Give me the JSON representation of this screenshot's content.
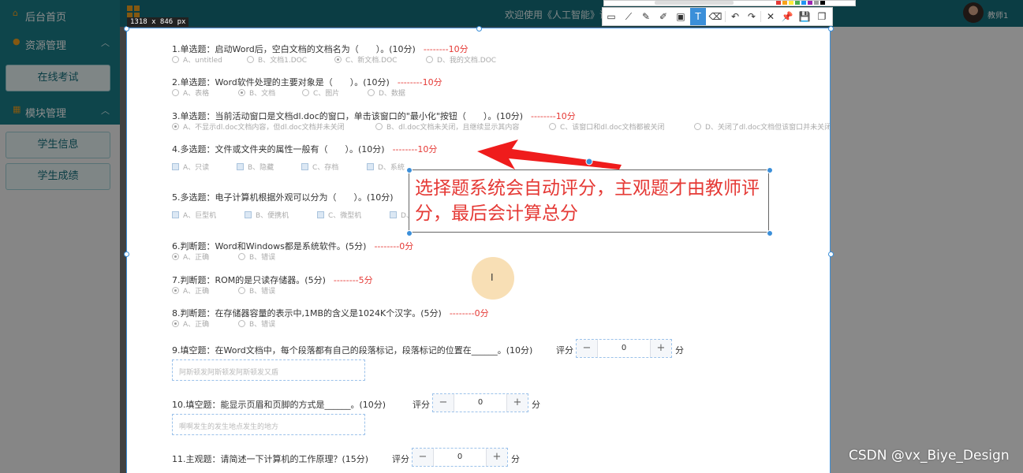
{
  "topbar": {
    "welcome": "欢迎使用《人工智能》课程",
    "username": "教师1"
  },
  "sidebar": {
    "home": "后台首页",
    "resource": "资源管理",
    "online_exam": "在线考试",
    "modules": "模块管理",
    "student_info": "学生信息",
    "student_scores": "学生成绩"
  },
  "size_badge": "1318 x 846  px",
  "questions": [
    {
      "title": "1.单选题：启动Word后，空白文档的文档名为（　　）。(10分)",
      "score": "--------10分",
      "options": [
        "A、untitled",
        "B、文档1.DOC",
        "C、新文档.DOC",
        "D、我的文档.DOC"
      ]
    },
    {
      "title": "2.单选题：Word软件处理的主要对象是（　　）。(10分)",
      "score": "--------10分",
      "options": [
        "A、表格",
        "B、文档",
        "C、图片",
        "D、数据"
      ]
    },
    {
      "title": "3.单选题：当前活动窗口是文档dl.doc的窗口，单击该窗口的\"最小化\"按钮（　　）。(10分)",
      "score": "--------10分",
      "options": [
        "A、不显示dl.doc文档内容，但dl.doc文档并未关闭",
        "B、dl.doc文档未关闭，且继续显示其内容",
        "C、该窗口和dl.doc文档都被关闭",
        "D、关闭了dl.doc文档但该窗口并未关闭"
      ]
    },
    {
      "title": "4.多选题：文件或文件夹的属性一般有（　　）。(10分)",
      "score": "--------10分",
      "options": [
        "A、只读",
        "B、隐藏",
        "C、存档",
        "D、系统"
      ]
    },
    {
      "title": "5.多选题：电子计算机根据外观可以分为（　　）。(10分)",
      "options": [
        "A、巨型机",
        "B、便携机",
        "C、微型机",
        "D、"
      ]
    },
    {
      "title": "6.判断题：Word和Windows都是系统软件。(5分)",
      "score": "--------0分",
      "options": [
        "A、正确",
        "B、错误"
      ]
    },
    {
      "title": "7.判断题：ROM的是只读存储器。(5分)",
      "score": "--------5分",
      "options": [
        "A、正确",
        "B、错误"
      ]
    },
    {
      "title": "8.判断题：在存储器容量的表示中,1MB的含义是1024K个汉字。(5分)",
      "score": "--------0分",
      "options": [
        "A、正确",
        "B、错误"
      ]
    },
    {
      "title": "9.填空题：在Word文档中，每个段落都有自己的段落标记，段落标记的位置在______。(10分)",
      "grade_label": "评分",
      "grade_value": "0",
      "unit": "分",
      "answer": "阿斯顿发阿斯顿发阿斯顿发又盾"
    },
    {
      "title": "10.填空题：能显示页眉和页脚的方式是______。(10分)",
      "grade_label": "评分",
      "grade_value": "0",
      "unit": "分",
      "answer": "啊啊发生的发生地点发生的地方"
    },
    {
      "title": "11.主观题：请简述一下计算机的工作原理？(15分)",
      "grade_label": "评分",
      "grade_value": "0",
      "unit": "分"
    }
  ],
  "annotation": "选择题系统会自动评分，主观题才由教师评分，最后会计算总分",
  "stepper": {
    "minus": "−",
    "plus": "+"
  },
  "cursor": "I",
  "watermark": "CSDN @vx_Biye_Design",
  "toolbar": {
    "icons": [
      "rect-select-icon",
      "line-icon",
      "pen-icon",
      "marker-icon",
      "mosaic-icon",
      "text-icon",
      "eraser-icon",
      "undo-icon",
      "redo-icon",
      "close-icon",
      "pin-icon",
      "save-icon",
      "copy-icon"
    ],
    "glyphs": [
      "▭",
      "⟋",
      "✎",
      "✐",
      "▣",
      "T",
      "⌫",
      "↶",
      "↷",
      "✕",
      "📌",
      "💾",
      "❐"
    ]
  },
  "colors": {
    "topbar": "#15707d",
    "sidebar": "#1b7f89",
    "score_red": "#e53935",
    "accent_blue": "#3b8fd9"
  }
}
